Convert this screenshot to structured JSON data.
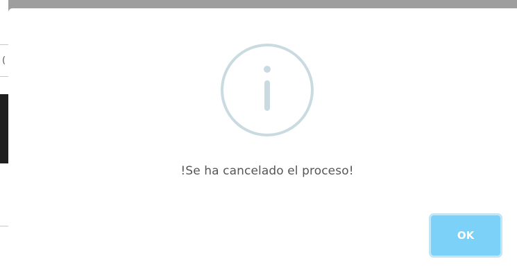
{
  "dialog": {
    "icon": "info-icon",
    "message": "!Se ha cancelado el proceso!",
    "ok_label": "OK",
    "colors": {
      "icon_stroke": "#c9dae1",
      "button_bg": "#7cd1f9",
      "message_text": "#565656"
    }
  }
}
